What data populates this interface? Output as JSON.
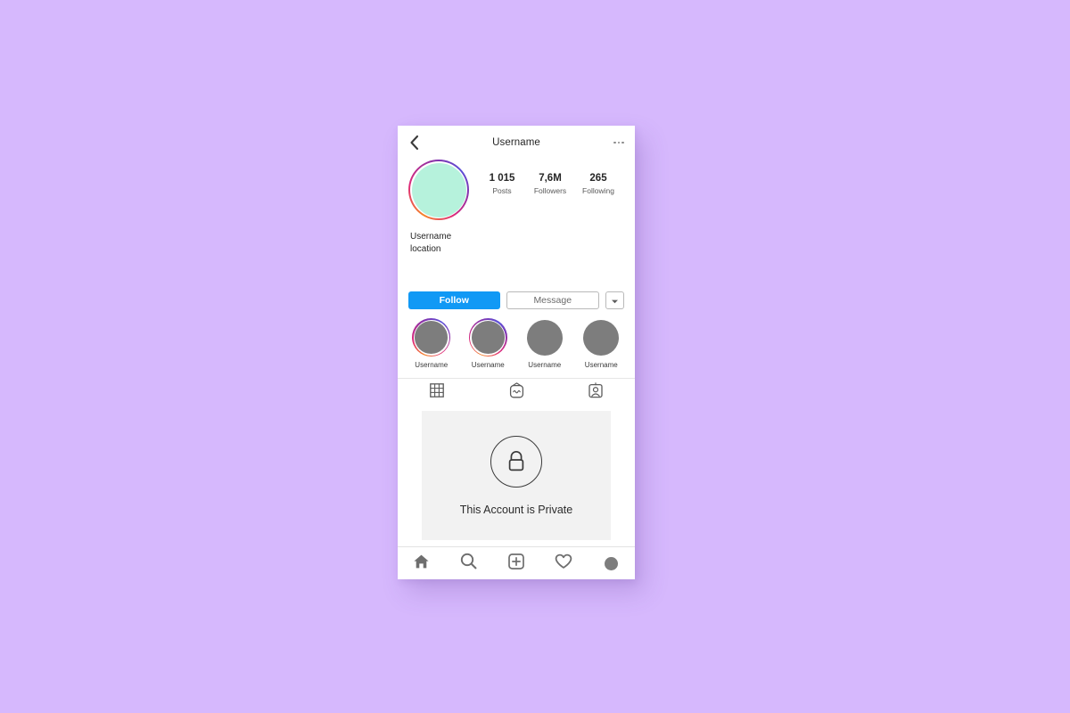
{
  "background": {
    "color": "#d6b8fd"
  },
  "theme": {
    "accent_blue": "#1199f5",
    "avatar_fill": "#b6f2dc",
    "placeholder_gray": "#7d7d7d",
    "panel_gray": "#f2f2f2"
  },
  "topbar": {
    "back_icon": "chevron-left-icon",
    "title": "Username",
    "more_icon": "more-options-icon"
  },
  "profile": {
    "avatar_icon": "profile-avatar",
    "has_story_ring": true,
    "stats": [
      {
        "value": "1 015",
        "label": "Posts"
      },
      {
        "value": "7,6M",
        "label": "Followers"
      },
      {
        "value": "265",
        "label": "Following"
      }
    ],
    "bio": {
      "name": "Username",
      "location": "location"
    }
  },
  "actions": {
    "follow_label": "Follow",
    "message_label": "Message",
    "caret_icon": "chevron-down-icon"
  },
  "highlights": [
    {
      "label": "Username",
      "ring": true
    },
    {
      "label": "Username",
      "ring": true
    },
    {
      "label": "Username",
      "ring": false
    },
    {
      "label": "Username",
      "ring": false
    }
  ],
  "tabs": [
    {
      "name": "grid-tab",
      "icon": "grid-icon",
      "selected": true
    },
    {
      "name": "igtv-tab",
      "icon": "igtv-icon",
      "selected": false
    },
    {
      "name": "tagged-tab",
      "icon": "tagged-person-icon",
      "selected": false
    }
  ],
  "private_panel": {
    "lock_icon": "lock-icon",
    "message": "This Account is Private"
  },
  "bottom_nav": [
    {
      "name": "nav-home",
      "icon": "home-icon"
    },
    {
      "name": "nav-search",
      "icon": "search-icon"
    },
    {
      "name": "nav-add-post",
      "icon": "add-post-icon"
    },
    {
      "name": "nav-activity",
      "icon": "heart-icon"
    },
    {
      "name": "nav-profile",
      "icon": "profile-circle-icon"
    }
  ]
}
